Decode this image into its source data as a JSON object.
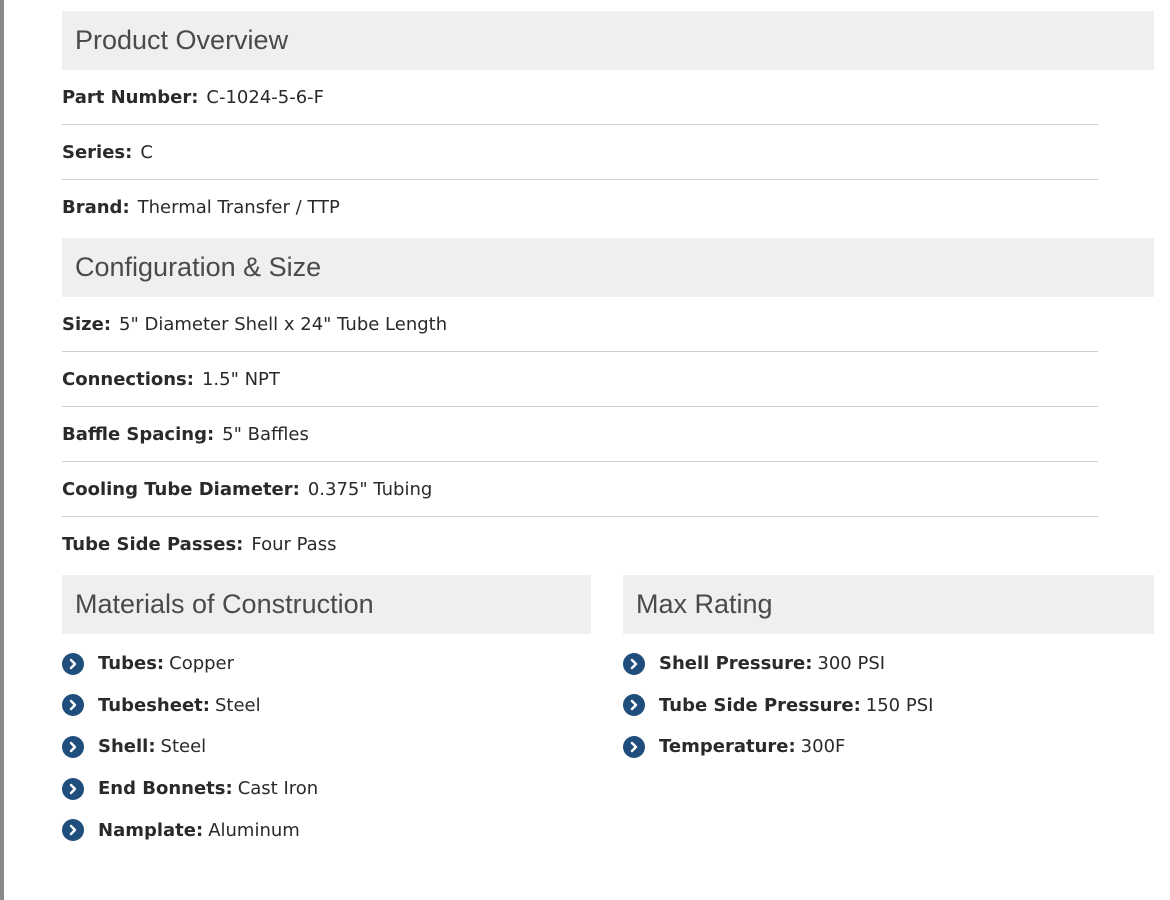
{
  "overview": {
    "title": "Product Overview",
    "items": [
      {
        "label": "Part Number:",
        "value": "C-1024-5-6-F"
      },
      {
        "label": "Series:",
        "value": "C"
      },
      {
        "label": "Brand:",
        "value": "Thermal Transfer / TTP"
      }
    ]
  },
  "configuration": {
    "title": "Configuration & Size",
    "items": [
      {
        "label": "Size:",
        "value": "5\" Diameter Shell x 24\" Tube Length"
      },
      {
        "label": "Connections:",
        "value": "1.5\" NPT"
      },
      {
        "label": "Baffle Spacing:",
        "value": "5\" Baffles"
      },
      {
        "label": "Cooling Tube Diameter:",
        "value": "0.375\" Tubing"
      },
      {
        "label": "Tube Side Passes:",
        "value": "Four Pass"
      }
    ]
  },
  "materials": {
    "title": "Materials of Construction",
    "items": [
      {
        "label": "Tubes:",
        "value": "Copper"
      },
      {
        "label": "Tubesheet:",
        "value": "Steel"
      },
      {
        "label": "Shell:",
        "value": "Steel"
      },
      {
        "label": "End Bonnets:",
        "value": "Cast Iron"
      },
      {
        "label": "Namplate:",
        "value": "Aluminum"
      }
    ]
  },
  "max_rating": {
    "title": "Max Rating",
    "items": [
      {
        "label": "Shell Pressure:",
        "value": "300 PSI"
      },
      {
        "label": "Tube Side Pressure:",
        "value": "150 PSI"
      },
      {
        "label": "Temperature:",
        "value": "300F"
      }
    ]
  },
  "icons": {
    "bullet": "chevron-right-circle-icon"
  },
  "colors": {
    "header_bg": "#efefef",
    "bullet": "#1f4e7c",
    "divider": "#cfcfcf"
  }
}
